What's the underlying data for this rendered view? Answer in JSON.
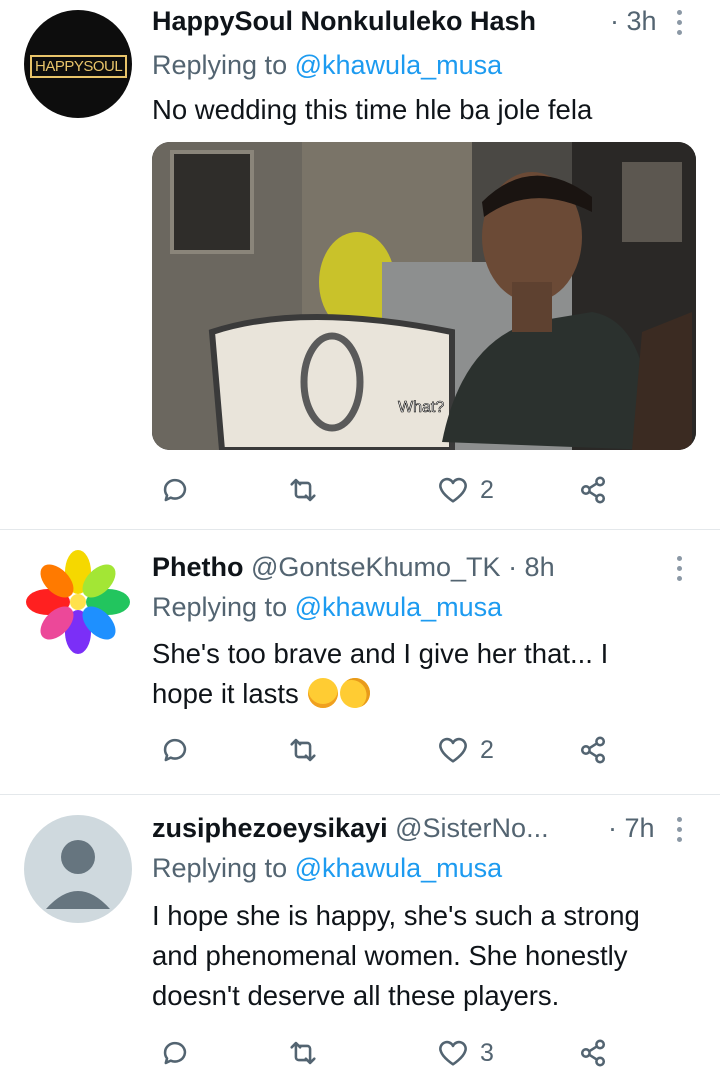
{
  "tweets": [
    {
      "name": "HappySoul Nonkululeko Hash",
      "handle": "",
      "time": "· 3h",
      "avatar_text": "HAPPYSOUL",
      "reply_prefix": "Replying to",
      "reply_to": "@khawula_musa",
      "text": "No wedding this time hle ba jole fela",
      "media_caption": "What?",
      "likes": "2",
      "retweets": "",
      "replies": ""
    },
    {
      "name": "Phetho",
      "handle": "@GontseKhumo_TK",
      "time": "· 8h",
      "reply_prefix": "Replying to",
      "reply_to": "@khawula_musa",
      "text_line1": "She's too brave and I give her that... I",
      "text_line2": "hope it lasts",
      "likes": "2"
    },
    {
      "name": "zusiphezoeysikayi",
      "handle": "@SisterNo...",
      "time": "· 7h",
      "reply_prefix": "Replying to",
      "reply_to": "@khawula_musa",
      "text_line1": "I hope she is happy, she's such a strong",
      "text_line2": "and phenomenal women. She honestly",
      "text_line3": "doesn't deserve all these players.",
      "likes": "3"
    }
  ],
  "colors": {
    "accent": "#1d9bf0",
    "secondary_text": "#536471",
    "primary_text": "#0f1419",
    "divider": "#e4e8eb"
  },
  "icons": [
    "reply-icon",
    "retweet-icon",
    "like-icon",
    "share-icon",
    "more-icon"
  ]
}
